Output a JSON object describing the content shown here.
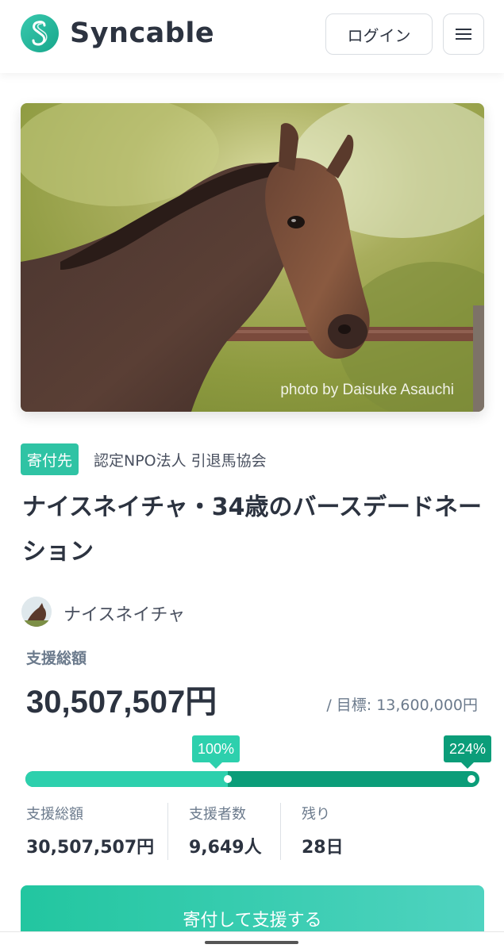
{
  "header": {
    "brand": "Syncable",
    "login_label": "ログイン"
  },
  "hero": {
    "photo_credit": "photo by Daisuke Asauchi"
  },
  "project": {
    "badge": "寄付先",
    "organization": "認定NPO法人 引退馬協会",
    "title": "ナイスネイチャ・34歳のバースデードネーション",
    "author": "ナイスネイチャ"
  },
  "funding": {
    "total_label": "支援総額",
    "total_amount": "30,507,507円",
    "goal_text": "/ 目標: 13,600,000円",
    "progress_percent": 224,
    "milestone_labels": [
      "100%",
      "224%"
    ]
  },
  "stats": [
    {
      "label": "支援総額",
      "value": "30,507,507円"
    },
    {
      "label": "支援者数",
      "value": "9,649人"
    },
    {
      "label": "残り",
      "value": "28日"
    }
  ],
  "cta": {
    "donate_label": "寄付して支援する"
  },
  "colors": {
    "accent": "#2dd0ad",
    "accent_dark": "#0b9d79",
    "text": "#2c3340",
    "muted": "#6b7a8c"
  },
  "icons": {
    "logo": "syncable-s-logo",
    "menu": "hamburger-icon"
  }
}
